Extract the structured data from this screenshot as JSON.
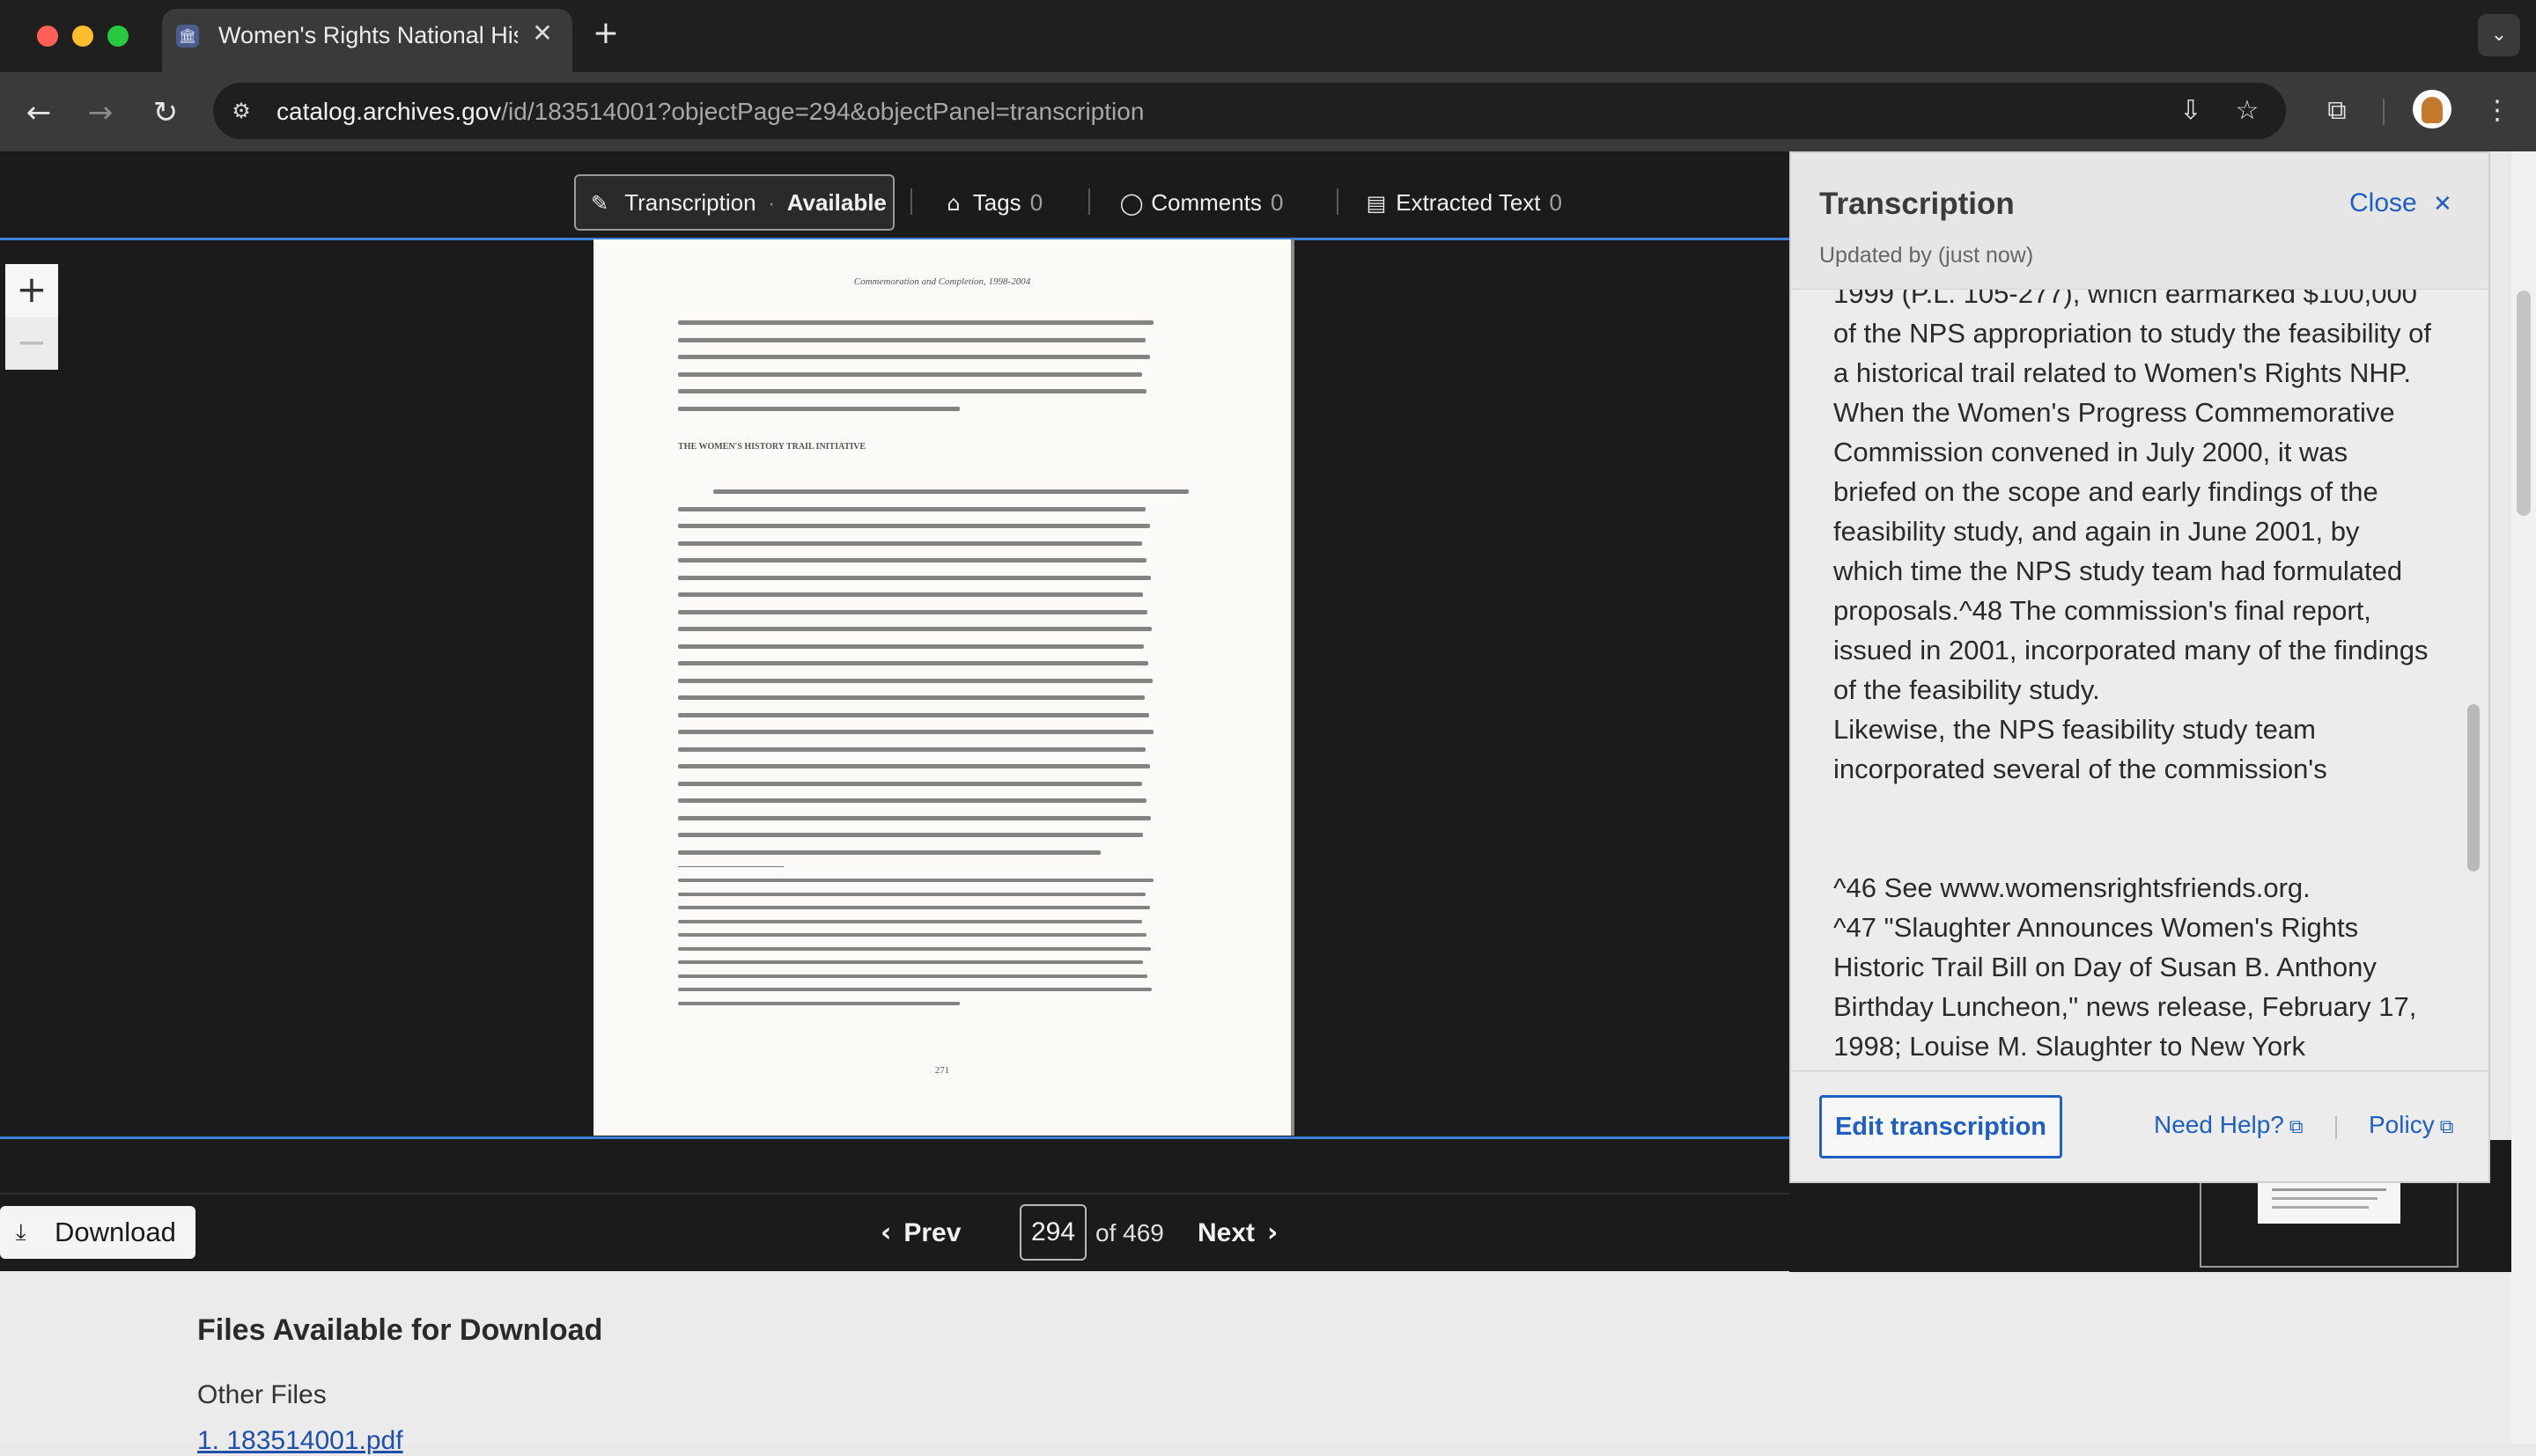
{
  "browser": {
    "tab_title": "Women's Rights National Hist",
    "tab_favicon": "🏛",
    "tab_close": "✕",
    "new_tab": "+",
    "url_domain": "catalog.archives.gov",
    "url_path": "/id/183514001?objectPage=294&objectPanel=transcription",
    "icons": {
      "back": "←",
      "forward": "→",
      "reload": "↻",
      "site_info": "⚙",
      "install": "⇩",
      "bookmark": "☆",
      "extensions": "⧉",
      "menu": "⋮",
      "tab_menu": "⌄"
    }
  },
  "viewer": {
    "tabs": [
      {
        "label": "Transcription",
        "status": "Available",
        "icon": "✎"
      },
      {
        "label": "Tags",
        "count": "0",
        "icon": "⌂"
      },
      {
        "label": "Comments",
        "count": "0",
        "icon": "◯"
      },
      {
        "label": "Extracted Text",
        "count": "0",
        "icon": "▤"
      }
    ],
    "zoom_in": "+",
    "zoom_out": "−",
    "page_doc": {
      "header": "Commemoration and Completion, 1998-2004",
      "section_heading": "THE WOMEN'S HISTORY TRAIL INITIATIVE",
      "page_number": "271"
    }
  },
  "pager": {
    "download_icon": "⤓",
    "download_label": "Download",
    "prev_label": "Prev",
    "prev_icon": "‹",
    "page_value": "294",
    "of_label": "of 469",
    "next_label": "Next",
    "next_icon": "›"
  },
  "files": {
    "heading": "Files Available for Download",
    "subheading": "Other Files",
    "first_file": "1. 183514001.pdf"
  },
  "panel": {
    "title": "Transcription",
    "close_label": "Close",
    "close_icon": "✕",
    "updated": "Updated by (just now)",
    "paragraphs": [
      "1999 (P.L. 105-277), which earmarked $100,000 of the NPS appropriation to study the feasibility of a historical trail related to Women's Rights NHP. When the Women's Progress Commemorative Commission convened in July 2000, it was briefed on the scope and early findings of the feasibility study, and again in June 2001, by which time the NPS study team had formulated proposals.^48 The commission's final report, issued in 2001, incorporated many of the findings of the feasibility study.",
      "Likewise, the NPS feasibility study team incorporated several of the commission's",
      "",
      "^46 See www.womensrightsfriends.org.",
      "^47 \"Slaughter Announces Women's Rights Historic Trail Bill on Day of Susan B. Anthony Birthday Luncheon,\" news release, February 17, 1998; Louise M. Slaughter to New York"
    ],
    "edit_label": "Edit transcription",
    "help_label": "Need Help?",
    "policy_label": "Policy",
    "external_icon": "⧉"
  }
}
